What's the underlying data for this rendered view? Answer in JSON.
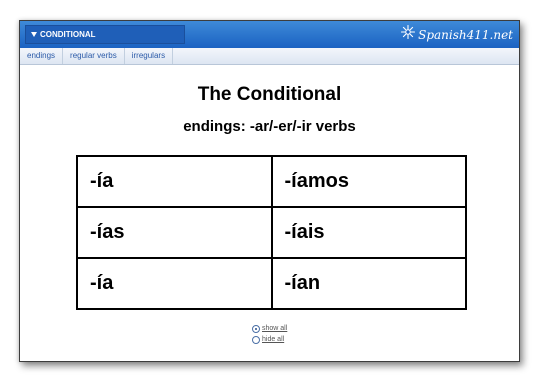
{
  "header": {
    "dropdown_label": "CONDITIONAL",
    "logo_text": "Spanish411.net",
    "logo_icon": "sunburst-icon",
    "bar_color": "#1b62c2"
  },
  "tabs": [
    {
      "label": "endings"
    },
    {
      "label": "regular verbs"
    },
    {
      "label": "irregulars"
    }
  ],
  "main": {
    "title": "The Conditional",
    "subtitle": "endings: -ar/-er/-ir verbs",
    "table": {
      "rows": [
        [
          "-ía",
          "-íamos"
        ],
        [
          "-ías",
          "-íais"
        ],
        [
          "-ía",
          "-ían"
        ]
      ]
    }
  },
  "options": [
    {
      "label": "show all",
      "checked": true
    },
    {
      "label": "hide all",
      "checked": false
    }
  ]
}
